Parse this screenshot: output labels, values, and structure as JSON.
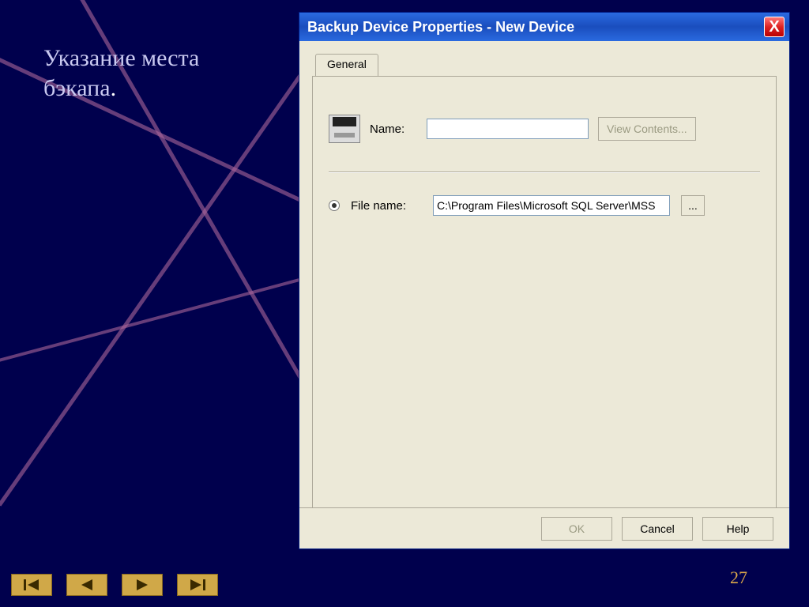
{
  "slide": {
    "caption_line1": "Указание места",
    "caption_line2": "бэкапа",
    "caption_dot": ".",
    "page_number": "27"
  },
  "dialog": {
    "title": "Backup Device Properties - New Device",
    "close_glyph": "X",
    "tab_label": "General",
    "name_label": "Name:",
    "name_value": "",
    "view_contents_label": "View Contents...",
    "file_name_label": "File name:",
    "file_name_value": "C:\\Program Files\\Microsoft SQL Server\\MSS",
    "browse_label": "...",
    "buttons": {
      "ok": "OK",
      "cancel": "Cancel",
      "help": "Help"
    }
  }
}
